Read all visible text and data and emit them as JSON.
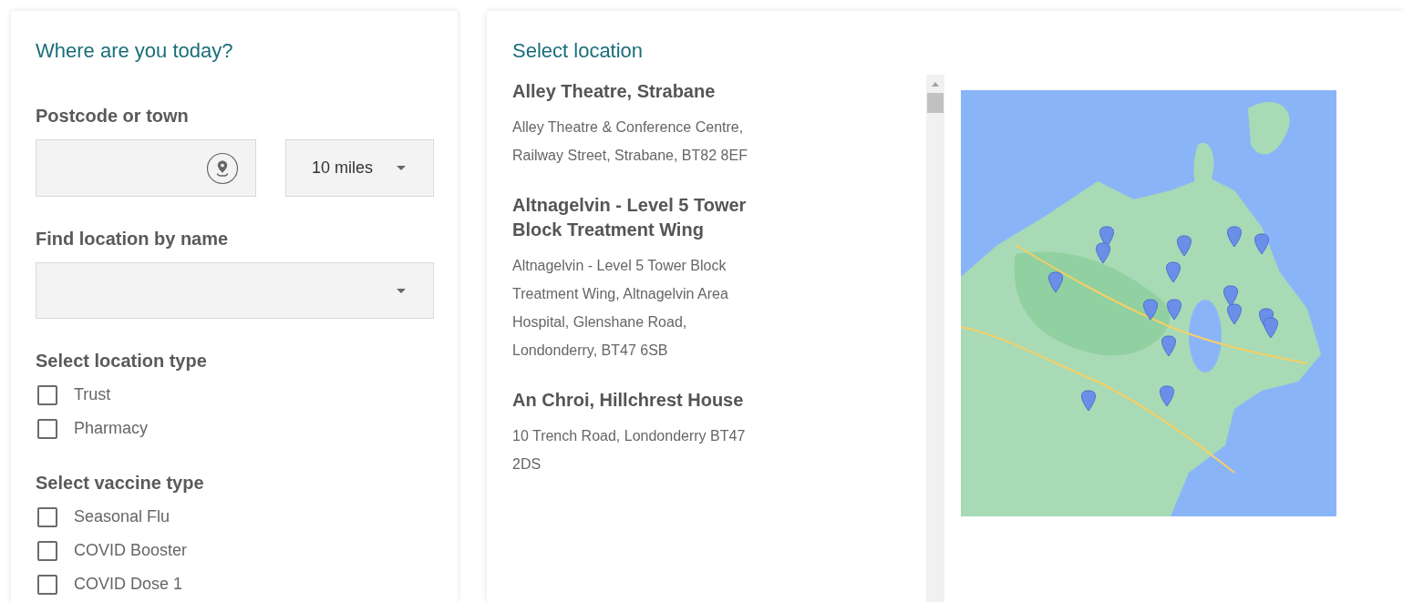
{
  "left_panel": {
    "title": "Where are you today?",
    "postcode": {
      "label": "Postcode or town",
      "distance": "10 miles"
    },
    "name_search": {
      "label": "Find location by name"
    },
    "location_types": {
      "label": "Select location type",
      "options": [
        {
          "label": "Trust",
          "checked": false
        },
        {
          "label": "Pharmacy",
          "checked": false
        }
      ]
    },
    "vaccine_types": {
      "label": "Select vaccine type",
      "options": [
        {
          "label": "Seasonal Flu",
          "checked": false
        },
        {
          "label": "COVID Booster",
          "checked": false
        },
        {
          "label": "COVID Dose 1",
          "checked": false
        }
      ]
    }
  },
  "right_panel": {
    "title": "Select location",
    "locations": [
      {
        "name": "Alley Theatre, Strabane",
        "address": "Alley Theatre & Conference Centre, Railway Street, Strabane, BT82 8EF"
      },
      {
        "name": "Altnagelvin - Level 5 Tower Block Treatment Wing",
        "address": "Altnagelvin - Level 5 Tower Block Treatment Wing, Altnagelvin Area Hospital, Glenshane Road, Londonderry, BT47 6SB"
      },
      {
        "name": "An Chroi, Hillchrest House",
        "address": "10 Trench Road, Londonderry BT47 2DS"
      }
    ]
  }
}
